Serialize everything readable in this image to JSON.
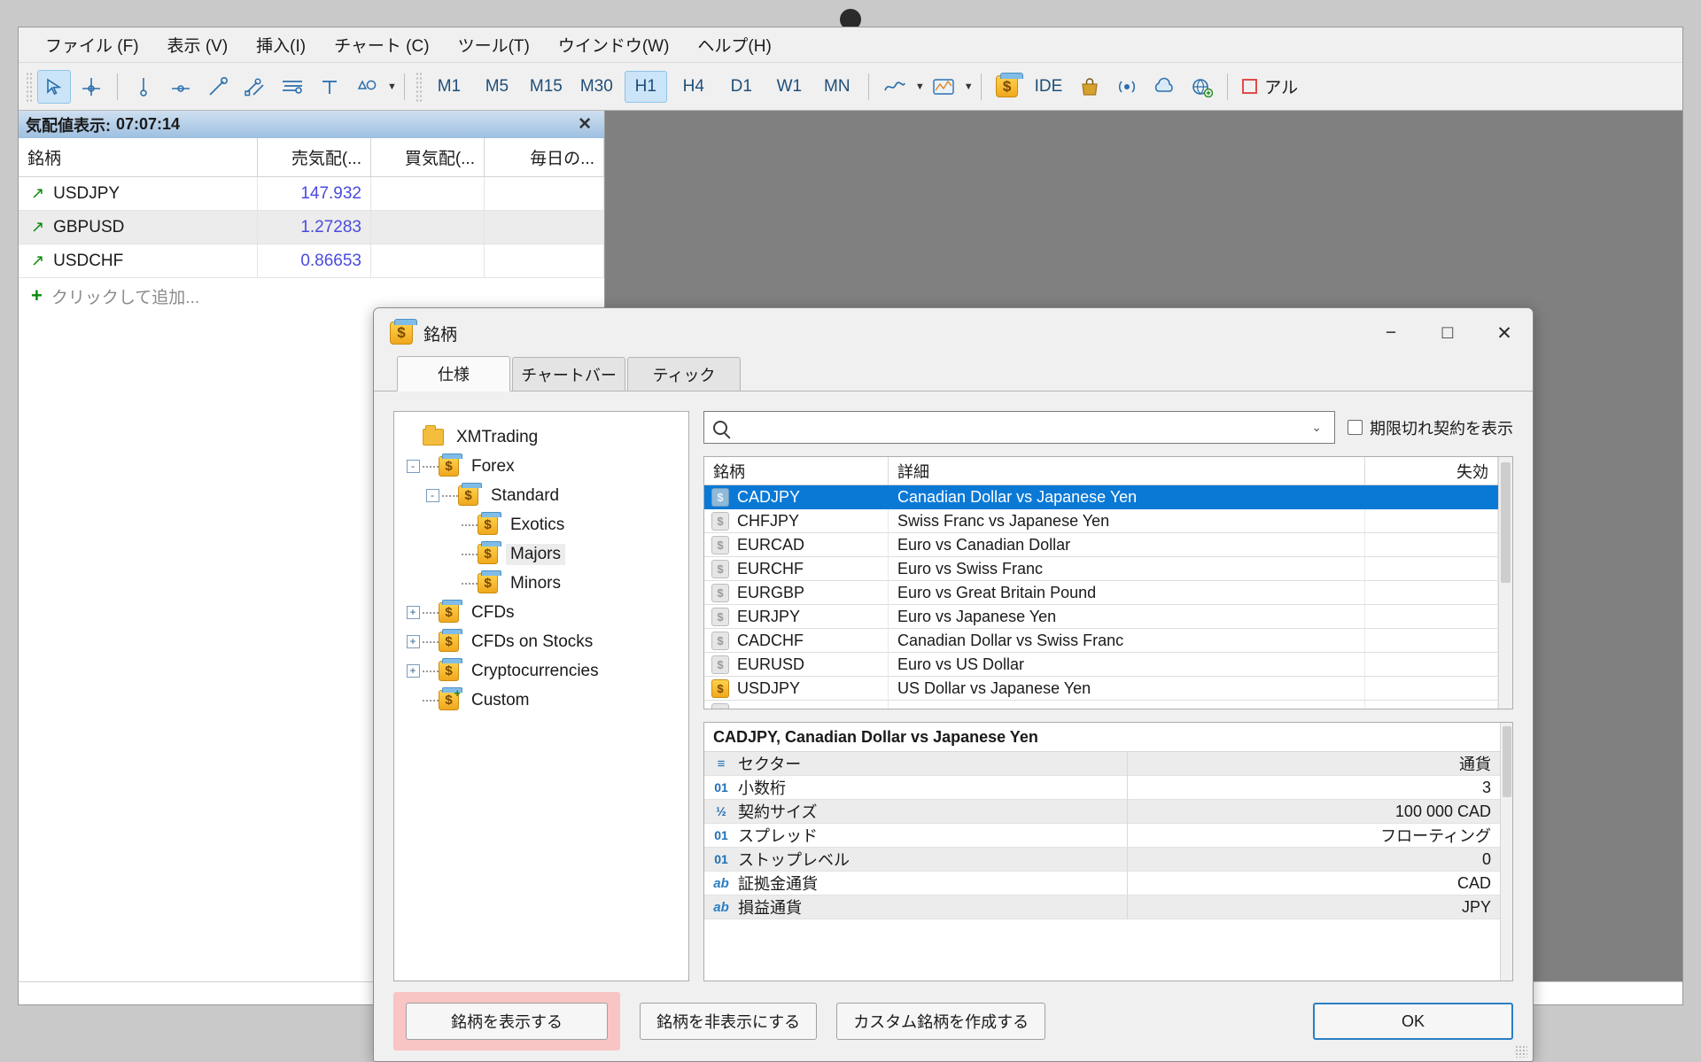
{
  "window": {
    "title": "銘柄"
  },
  "menubar": {
    "items": [
      {
        "label": "ファイル (F)",
        "name": "menu-file"
      },
      {
        "label": "表示 (V)",
        "name": "menu-view"
      },
      {
        "label": "挿入(I)",
        "name": "menu-insert"
      },
      {
        "label": "チャート (C)",
        "name": "menu-chart"
      },
      {
        "label": "ツール(T)",
        "name": "menu-tools"
      },
      {
        "label": "ウインドウ(W)",
        "name": "menu-window"
      },
      {
        "label": "ヘルプ(H)",
        "name": "menu-help"
      }
    ]
  },
  "toolbar": {
    "timeframes": [
      {
        "label": "M1",
        "active": false
      },
      {
        "label": "M5",
        "active": false
      },
      {
        "label": "M15",
        "active": false
      },
      {
        "label": "M30",
        "active": false
      },
      {
        "label": "H1",
        "active": true
      },
      {
        "label": "H4",
        "active": false
      },
      {
        "label": "D1",
        "active": false
      },
      {
        "label": "W1",
        "active": false
      },
      {
        "label": "MN",
        "active": false
      }
    ],
    "ide_label": "IDE",
    "alert_label": "アル",
    "icons": [
      "cursor-select-icon",
      "crosshair-icon",
      "vertical-line-icon",
      "horizontal-line-icon",
      "trendline-icon",
      "equidistant-channel-icon",
      "fibonacci-icon",
      "text-label-icon",
      "shapes-icon",
      "line-chart-icon",
      "indicators-icon",
      "symbols-icon",
      "market-icon",
      "signals-icon",
      "cloud-icon",
      "vps-icon"
    ]
  },
  "market_watch": {
    "title": "気配値表示:",
    "time": "07:07:14",
    "columns": [
      "銘柄",
      "売気配(...",
      "買気配(...",
      "毎日の..."
    ],
    "rows": [
      {
        "symbol": "USDJPY",
        "sell": "147.932",
        "buy": "",
        "daily": ""
      },
      {
        "symbol": "GBPUSD",
        "sell": "1.27283",
        "buy": "",
        "daily": ""
      },
      {
        "symbol": "USDCHF",
        "sell": "0.86653",
        "buy": "",
        "daily": ""
      }
    ],
    "add_label": "クリックして追加..."
  },
  "dialog": {
    "tabs": [
      {
        "label": "仕様",
        "active": true
      },
      {
        "label": "チャートバー",
        "active": false
      },
      {
        "label": "ティック",
        "active": false
      }
    ],
    "tree": [
      {
        "label": "XMTrading",
        "depth": 0,
        "icon": "folder",
        "toggle": "",
        "selected": false
      },
      {
        "label": "Forex",
        "depth": 1,
        "icon": "symbol",
        "toggle": "-",
        "selected": false
      },
      {
        "label": "Standard",
        "depth": 2,
        "icon": "symbol",
        "toggle": "-",
        "selected": false
      },
      {
        "label": "Exotics",
        "depth": 3,
        "icon": "symbol",
        "toggle": "",
        "selected": false
      },
      {
        "label": "Majors",
        "depth": 3,
        "icon": "symbol",
        "toggle": "",
        "selected": true
      },
      {
        "label": "Minors",
        "depth": 3,
        "icon": "symbol",
        "toggle": "",
        "selected": false
      },
      {
        "label": "CFDs",
        "depth": 1,
        "icon": "symbol",
        "toggle": "+",
        "selected": false
      },
      {
        "label": "CFDs on Stocks",
        "depth": 1,
        "icon": "symbol",
        "toggle": "+",
        "selected": false
      },
      {
        "label": "Cryptocurrencies",
        "depth": 1,
        "icon": "symbol",
        "toggle": "+",
        "selected": false
      },
      {
        "label": "Custom",
        "depth": 1,
        "icon": "custom",
        "toggle": "",
        "selected": false
      }
    ],
    "search": {
      "value": "",
      "placeholder": ""
    },
    "expired_label": "期限切れ契約を表示",
    "table": {
      "headers": [
        "銘柄",
        "詳細",
        "失効"
      ],
      "rows": [
        {
          "symbol": "CADJPY",
          "detail": "Canadian Dollar vs Japanese Yen",
          "expiry": "",
          "selected": true,
          "enabled": false
        },
        {
          "symbol": "CHFJPY",
          "detail": "Swiss Franc vs Japanese Yen",
          "expiry": "",
          "selected": false,
          "enabled": false
        },
        {
          "symbol": "EURCAD",
          "detail": "Euro vs Canadian Dollar",
          "expiry": "",
          "selected": false,
          "enabled": false
        },
        {
          "symbol": "EURCHF",
          "detail": "Euro vs Swiss Franc",
          "expiry": "",
          "selected": false,
          "enabled": false
        },
        {
          "symbol": "EURGBP",
          "detail": "Euro vs Great Britain Pound",
          "expiry": "",
          "selected": false,
          "enabled": false
        },
        {
          "symbol": "EURJPY",
          "detail": "Euro vs Japanese Yen",
          "expiry": "",
          "selected": false,
          "enabled": false
        },
        {
          "symbol": "CADCHF",
          "detail": "Canadian Dollar vs Swiss Franc",
          "expiry": "",
          "selected": false,
          "enabled": false
        },
        {
          "symbol": "EURUSD",
          "detail": "Euro vs US Dollar",
          "expiry": "",
          "selected": false,
          "enabled": false
        },
        {
          "symbol": "USDJPY",
          "detail": "US Dollar vs Japanese Yen",
          "expiry": "",
          "selected": false,
          "enabled": true
        }
      ]
    },
    "properties": {
      "title": "CADJPY, Canadian Dollar vs Japanese Yen",
      "rows": [
        {
          "icon": "sector",
          "key": "セクター",
          "value": "通貨"
        },
        {
          "icon": "01",
          "key": "小数桁",
          "value": "3"
        },
        {
          "icon": "half",
          "key": "契約サイズ",
          "value": "100 000 CAD"
        },
        {
          "icon": "01",
          "key": "スプレッド",
          "value": "フローティング"
        },
        {
          "icon": "01",
          "key": "ストップレベル",
          "value": "0"
        },
        {
          "icon": "ab",
          "key": "証拠金通貨",
          "value": "CAD"
        },
        {
          "icon": "ab",
          "key": "損益通貨",
          "value": "JPY"
        }
      ]
    },
    "footer": {
      "show_symbol": "銘柄を表示する",
      "hide_symbol": "銘柄を非表示にする",
      "create_custom": "カスタム銘柄を作成する",
      "ok": "OK"
    },
    "controls": {
      "minimize": "−",
      "maximize": "□",
      "close": "✕"
    }
  },
  "colors": {
    "accent": "#0a79d6",
    "highlight_pink": "#f9c4c4",
    "price_blue": "#4a4ae0",
    "up_green": "#0a8a0a",
    "tf_active": "#cce4f7"
  }
}
